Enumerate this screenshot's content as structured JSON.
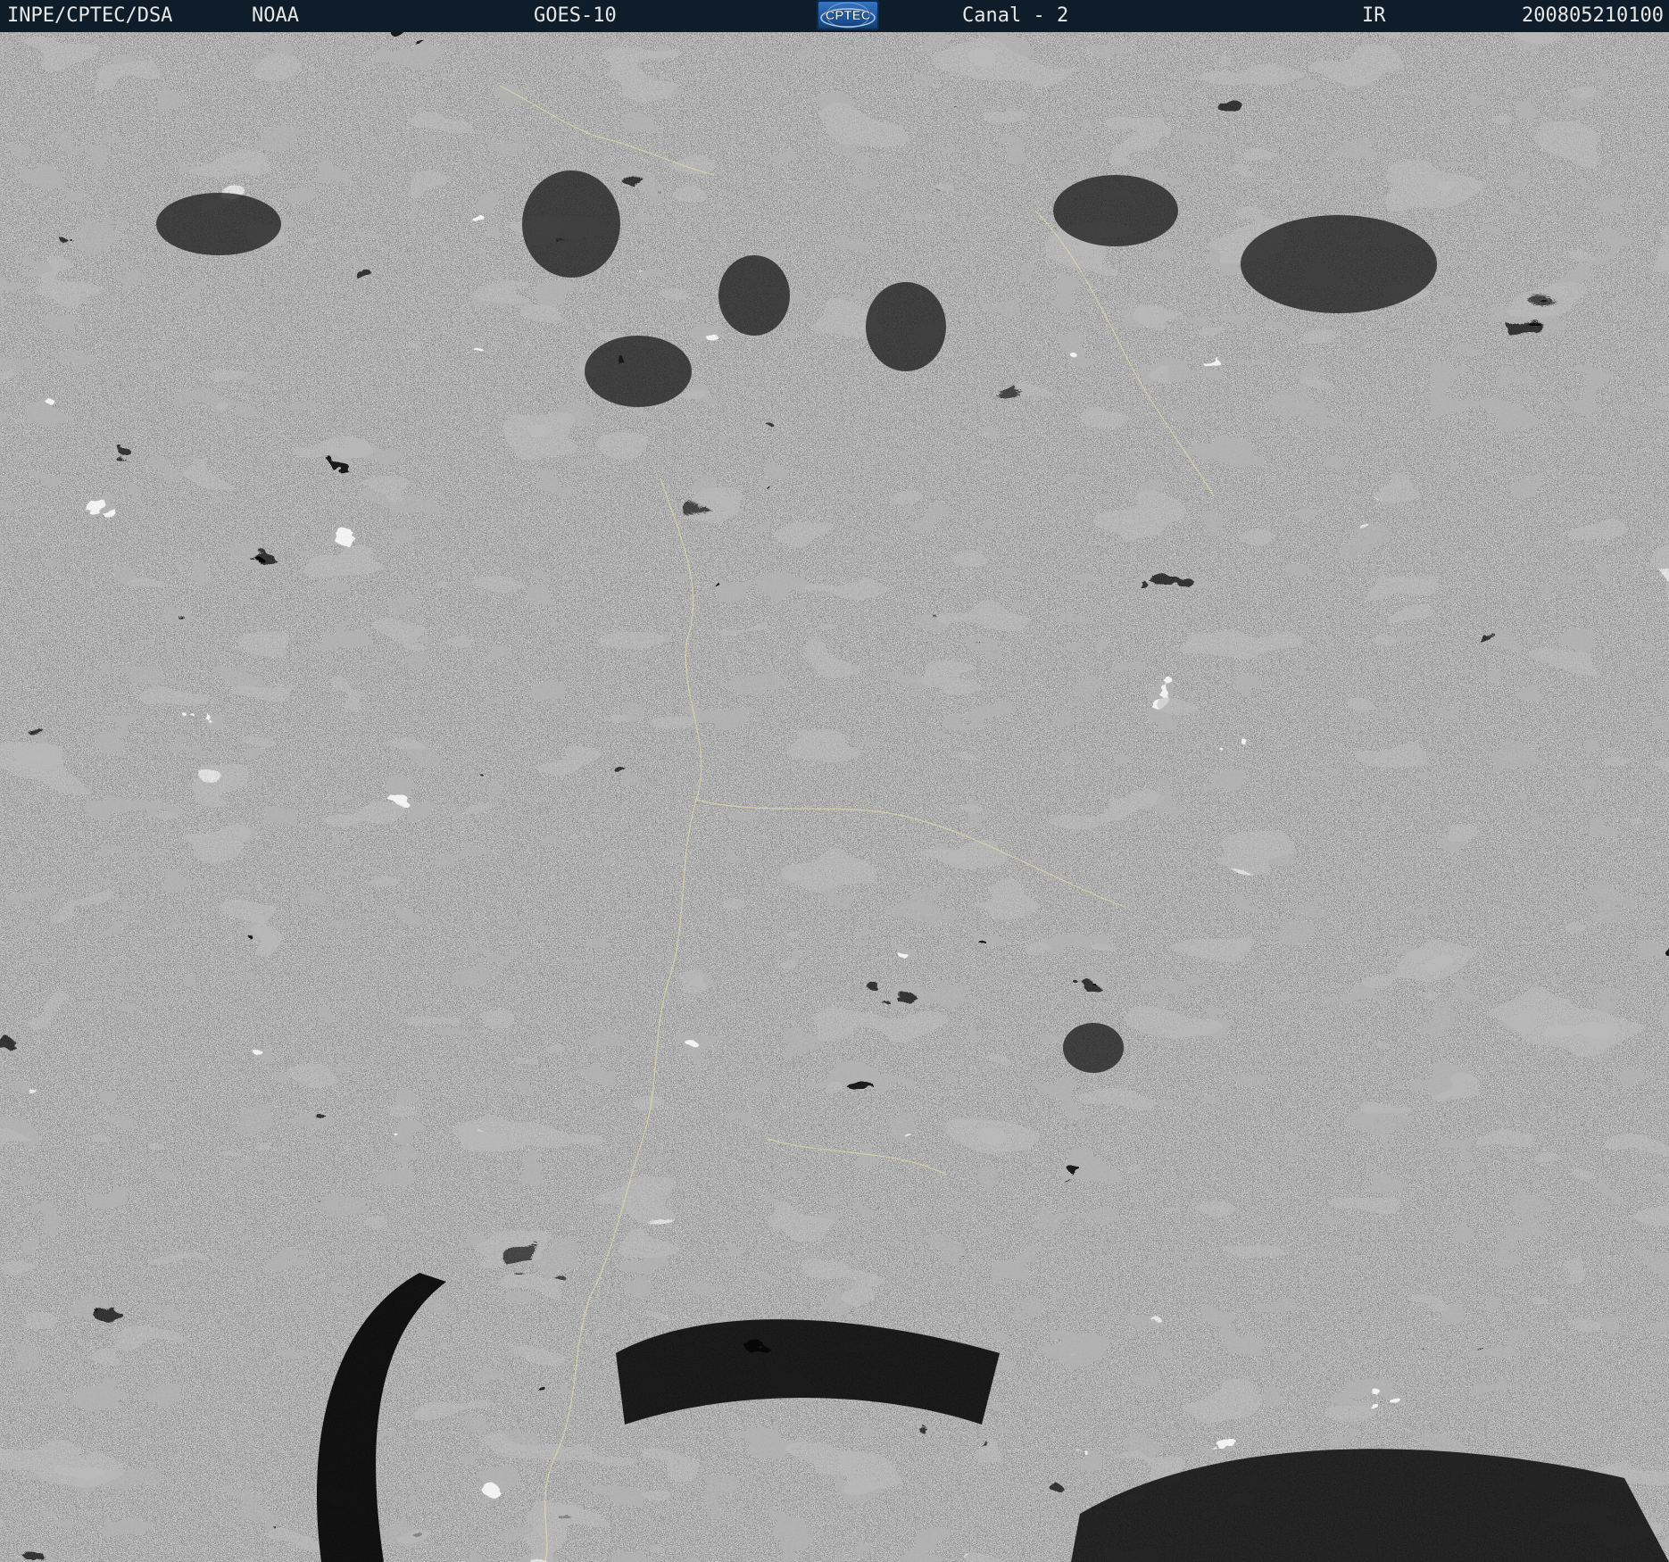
{
  "header": {
    "organization": "INPE/CPTEC/DSA",
    "agency": "NOAA",
    "satellite": "GOES-10",
    "channel": "Canal - 2",
    "band": "IR",
    "timestamp": "200805210100"
  },
  "logo": {
    "text": "CPTEC",
    "icon": "cptec-logo-icon"
  },
  "image": {
    "description_icon": "satellite-ir-image-icon"
  },
  "colors": {
    "header_bg": "#0f1c2a",
    "header_text": "#e8e8e8",
    "logo_blue": "#1b4f93",
    "coastline": "#e6e0a8"
  }
}
